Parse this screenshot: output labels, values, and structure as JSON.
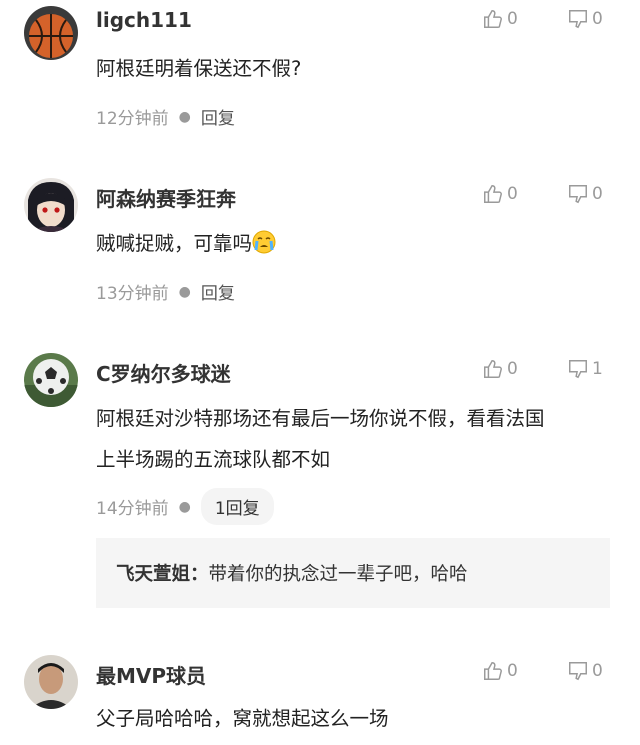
{
  "comments": [
    {
      "username": "ligch111",
      "likes": "0",
      "dislikes": "0",
      "text": "阿根廷明着保送还不假?",
      "time": "12分钟前",
      "reply_label": "回复",
      "avatar_icon": "basketball-icon"
    },
    {
      "username": "阿森纳赛季狂奔",
      "likes": "0",
      "dislikes": "0",
      "text": "贼喊捉贼，可靠吗",
      "emoji": "crying-face-icon",
      "time": "13分钟前",
      "reply_label": "回复",
      "avatar_icon": "anime-avatar-icon"
    },
    {
      "username": "C罗纳尔多球迷",
      "likes": "0",
      "dislikes": "1",
      "text_line1": "阿根廷对沙特那场还有最后一场你说不假，看看法国",
      "text_line2": "上半场踢的五流球队都不如",
      "time": "14分钟前",
      "reply_label": "1回复",
      "avatar_icon": "ball-avatar-icon",
      "quoted_reply": {
        "name": "飞天萱姐：",
        "text": "带着你的执念过一辈子吧，哈哈"
      }
    },
    {
      "username": "最MVP球员",
      "likes": "0",
      "dislikes": "0",
      "text": "父子局哈哈哈，窝就想起这么一场",
      "avatar_icon": "person-avatar-icon"
    }
  ],
  "colors": {
    "meta_gray": "#9a9a9a",
    "quote_bg": "#f5f5f5",
    "pill_bg": "#f4f4f4"
  }
}
